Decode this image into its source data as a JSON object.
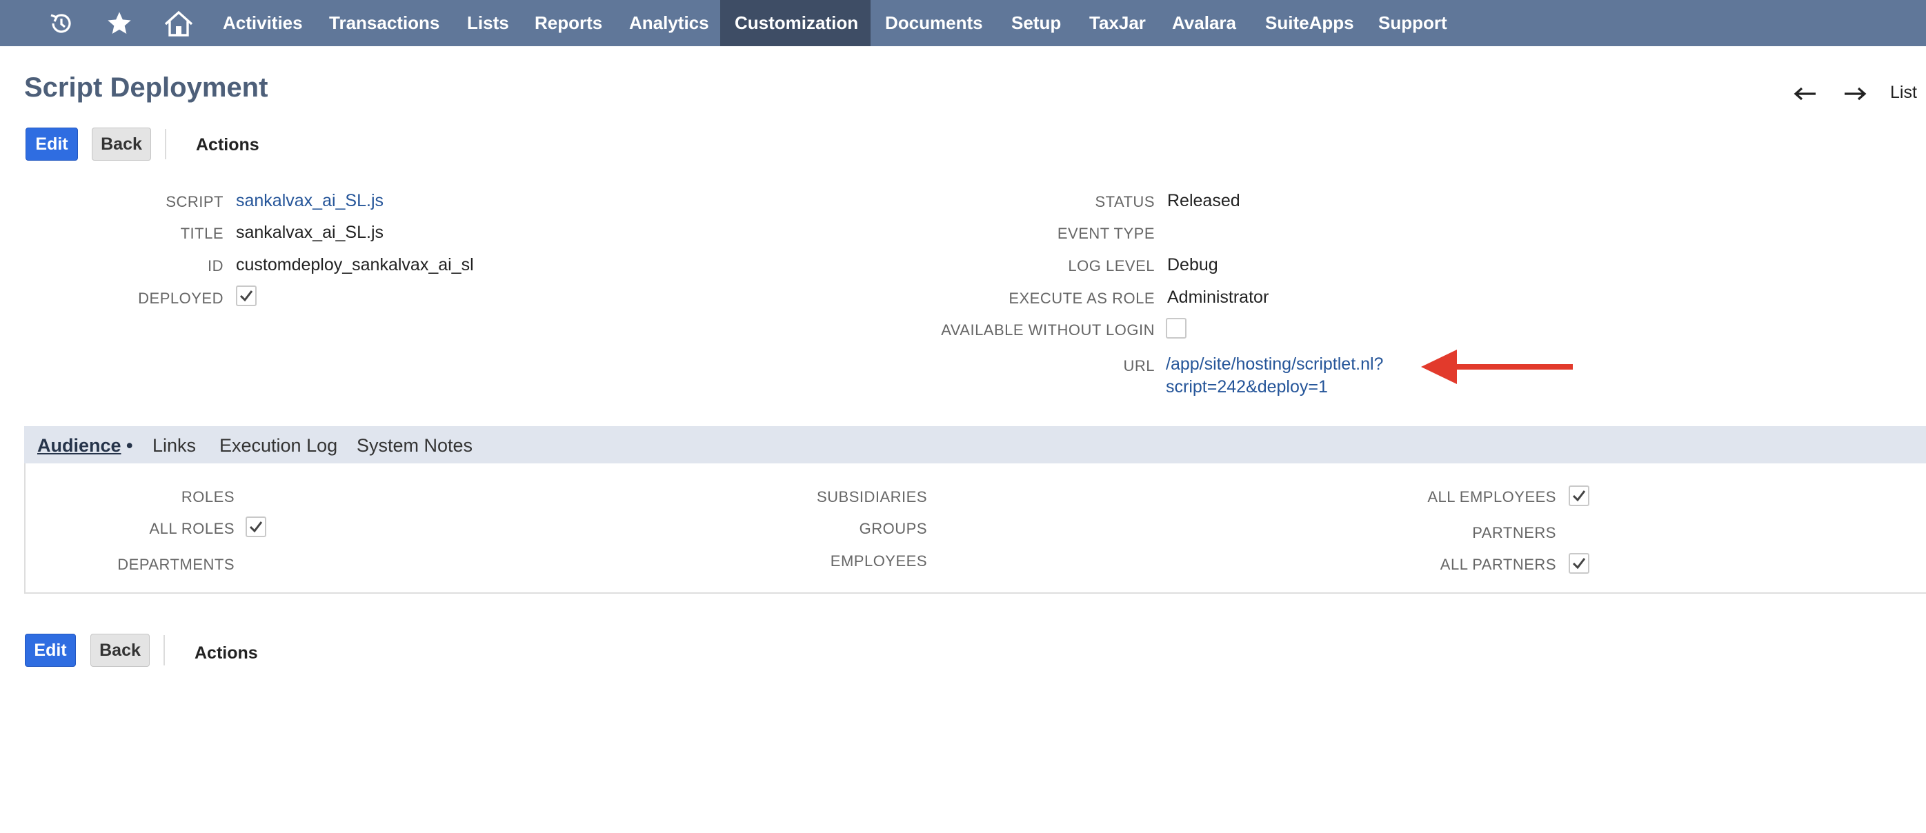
{
  "nav": {
    "icons": [
      "recent-records-icon",
      "star-icon",
      "home-icon"
    ],
    "items": [
      "Activities",
      "Transactions",
      "Lists",
      "Reports",
      "Analytics",
      "Customization",
      "Documents",
      "Setup",
      "TaxJar",
      "Avalara",
      "SuiteApps",
      "Support"
    ],
    "active": "Customization",
    "bar_color": "#607799",
    "active_color": "#3e4d65"
  },
  "header": {
    "title": "Script Deployment",
    "prev_icon": "arrow-left-icon",
    "next_icon": "arrow-right-icon",
    "list_label": "List"
  },
  "toolbar": {
    "edit_label": "Edit",
    "back_label": "Back",
    "actions_label": "Actions",
    "primary_color": "#2f6de1"
  },
  "fields_left": {
    "script_label": "SCRIPT",
    "script_value": "sankalvax_ai_SL.js",
    "title_label": "TITLE",
    "title_value": "sankalvax_ai_SL.js",
    "id_label": "ID",
    "id_value": "customdeploy_sankalvax_ai_sl",
    "deployed_label": "DEPLOYED",
    "deployed_checked": true
  },
  "fields_right": {
    "status_label": "STATUS",
    "status_value": "Released",
    "event_type_label": "EVENT TYPE",
    "event_type_value": "",
    "log_level_label": "LOG LEVEL",
    "log_level_value": "Debug",
    "execute_as_role_label": "EXECUTE AS ROLE",
    "execute_as_role_value": "Administrator",
    "available_without_login_label": "AVAILABLE WITHOUT LOGIN",
    "available_without_login_checked": false,
    "url_label": "URL",
    "url_line1": "/app/site/hosting/scriptlet.nl?",
    "url_line2": "script=242&deploy=1"
  },
  "annotation": {
    "arrow_color": "#e23a2c"
  },
  "tabs": {
    "audience": "Audience",
    "audience_suffix": "•",
    "links": "Links",
    "execution_log": "Execution Log",
    "system_notes": "System Notes",
    "active": "Audience"
  },
  "audience": {
    "roles_label": "ROLES",
    "all_roles_label": "ALL ROLES",
    "all_roles_checked": true,
    "departments_label": "DEPARTMENTS",
    "subsidiaries_label": "SUBSIDIARIES",
    "groups_label": "GROUPS",
    "employees_label": "EMPLOYEES",
    "all_employees_label": "ALL EMPLOYEES",
    "all_employees_checked": true,
    "partners_label": "PARTNERS",
    "all_partners_label": "ALL PARTNERS",
    "all_partners_checked": true
  }
}
